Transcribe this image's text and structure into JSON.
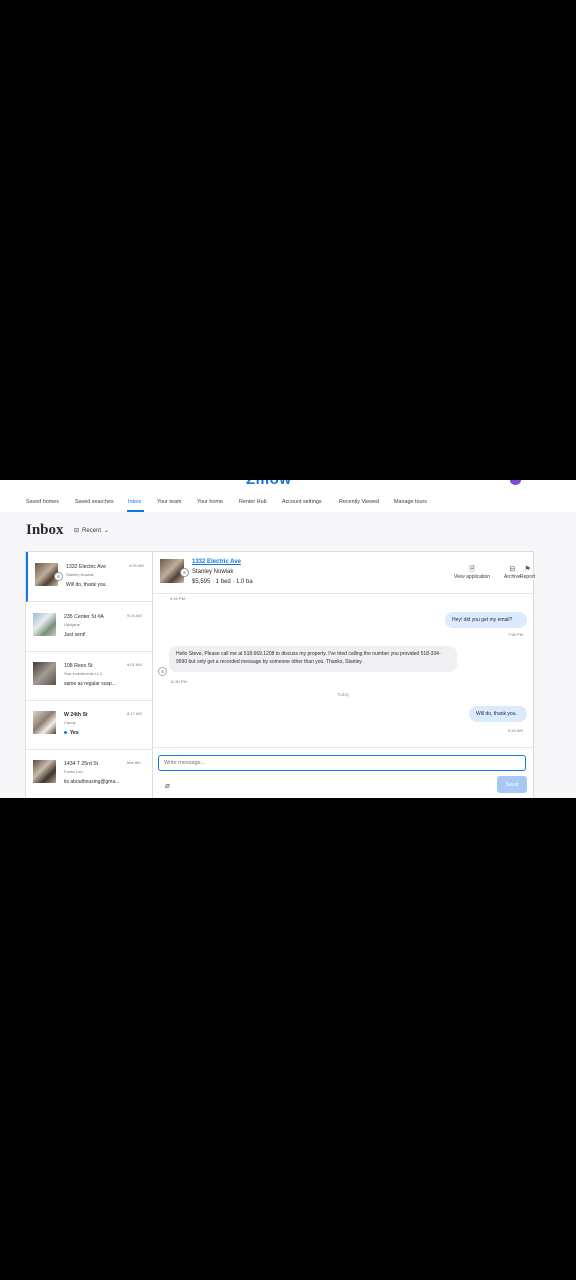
{
  "header": {
    "logo": "Zillow"
  },
  "nav": {
    "items": [
      {
        "label": "Saved homes"
      },
      {
        "label": "Saved searches"
      },
      {
        "label": "Inbox"
      },
      {
        "label": "Your team"
      },
      {
        "label": "Your home"
      },
      {
        "label": "Renter Hub"
      },
      {
        "label": "Account settings"
      },
      {
        "label": "Recently Viewed"
      },
      {
        "label": "Manage tours"
      }
    ],
    "active": "Inbox"
  },
  "inbox": {
    "title": "Inbox",
    "sort_label": "Recent"
  },
  "conversations": [
    {
      "address": "1332 Electric Ave",
      "contact": "Stanley Nowiak",
      "preview": "Will do, thank you.",
      "time": "9:29 AM",
      "unread": false,
      "selected": true
    },
    {
      "address": "235 Center St #A",
      "contact": "Upstjane",
      "preview": "Just sent!",
      "time": "9:24 AM",
      "unread": false,
      "selected": false
    },
    {
      "address": "108 Rees St",
      "contact": "Star Investments LLC",
      "preview": "same as regular susp...",
      "time": "9:01 AM",
      "unread": false,
      "selected": false
    },
    {
      "address": "W 24th St",
      "contact": "Candy",
      "preview": "Yes",
      "time": "8:17 AM",
      "unread": true,
      "selected": false
    },
    {
      "address": "1434 T 25rd St",
      "contact": "Fosso Lau",
      "preview": "its abouthousing@gma...",
      "time": "Mar 6th",
      "unread": false,
      "selected": false
    }
  ],
  "thread": {
    "address": "1332 Electric Ave",
    "contact": "Stanley Nowiak",
    "details": "$5,595 · 1 bed · 1.0 ba",
    "actions": [
      {
        "label": "View application",
        "icon": "document-icon"
      },
      {
        "label": "Archive",
        "icon": "archive-icon"
      },
      {
        "label": "Report",
        "icon": "flag-icon"
      }
    ],
    "top_time": "4:15 PM",
    "messages": [
      {
        "direction": "out",
        "text": "Hey! did you get my email?",
        "time": "7:55 PM"
      },
      {
        "direction": "in",
        "text": "Hello Steve, Please call me at 518.669.1208 to discuss my property. I've tried calling the number you provided 518-334-9590 but only get a recorded message by someone other than you. Thanks, Stanley",
        "time": "11:30 PM",
        "sender_initial": "S"
      },
      {
        "direction": "out",
        "text": "Will do, thank you.",
        "time": "9:29 AM"
      }
    ],
    "day_separator": "Today"
  },
  "compose": {
    "placeholder": "Write message...",
    "send_label": "Send"
  }
}
